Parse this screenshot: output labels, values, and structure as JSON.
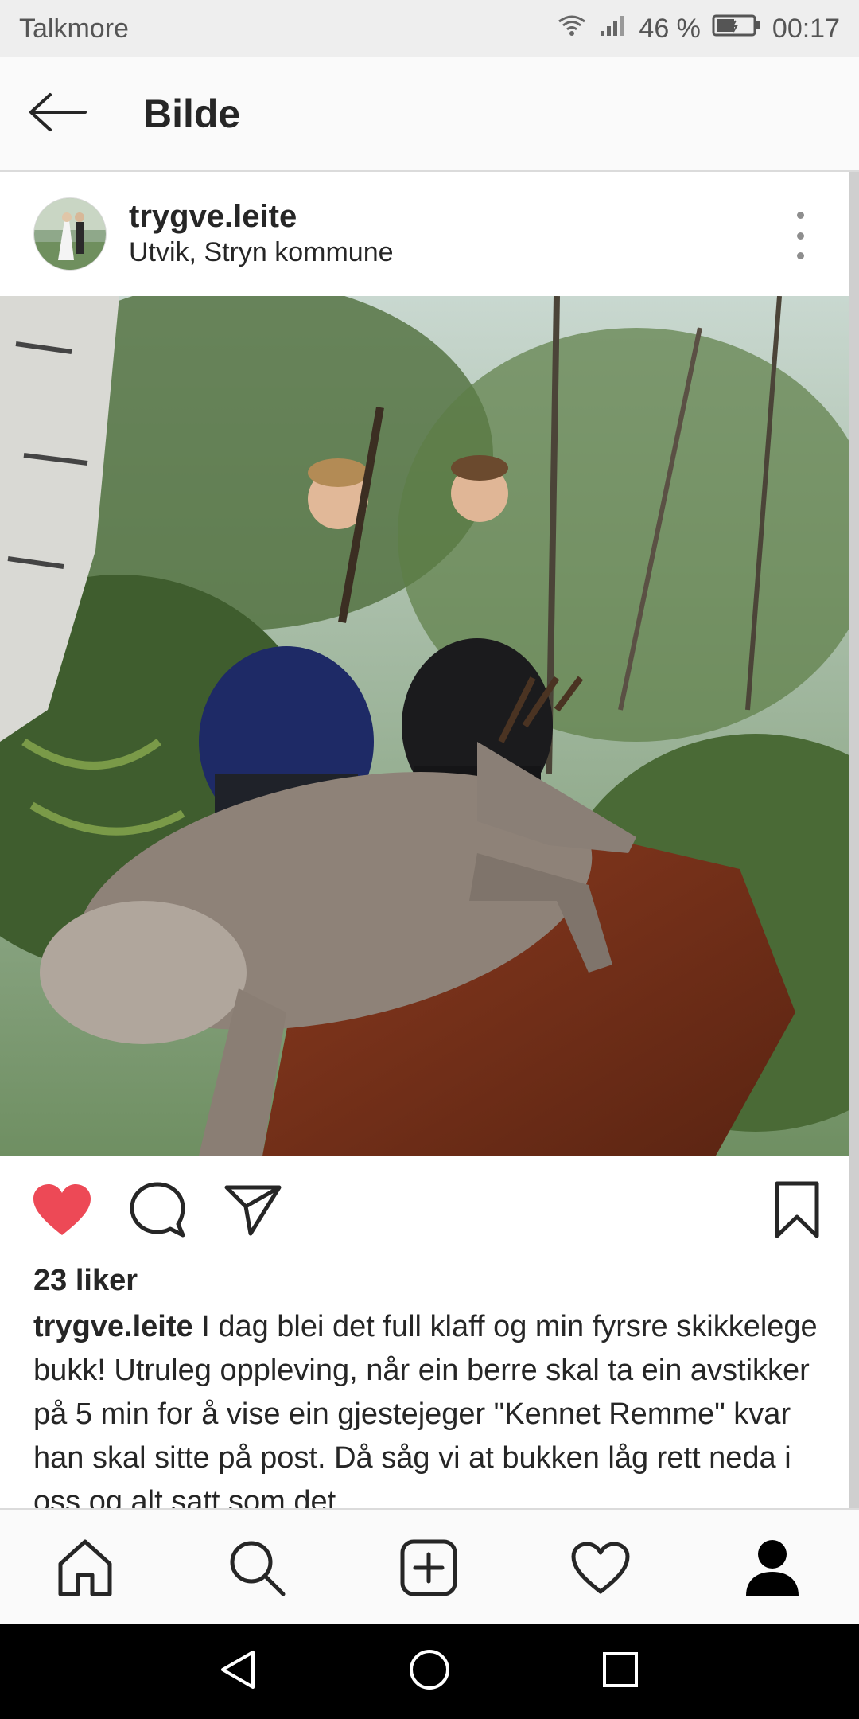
{
  "status_bar": {
    "carrier": "Talkmore",
    "battery": "46 %",
    "time": "00:17",
    "icons": [
      "wifi-icon",
      "signal-icon",
      "battery-icon"
    ]
  },
  "app_bar": {
    "title": "Bilde",
    "back_icon": "arrow-left-icon"
  },
  "post": {
    "username": "trygve.leite",
    "location": "Utvik, Stryn kommune",
    "more_icon": "more-vertical-icon",
    "liked": true,
    "likes": "23 liker",
    "caption_user": "trygve.leite",
    "caption_text": " I dag blei det full klaff og min fyrsre skikkelege bukk! Utruleg oppleving, når ein berre skal ta ein avstikker på 5 min for å vise ein gjestejeger \"Kennet Remme\" kvar han skal sitte på post. Då såg vi at bukken låg rett neda i oss og alt satt som det",
    "action_icons": [
      "heart-filled-icon",
      "comment-icon",
      "share-icon",
      "bookmark-icon"
    ]
  },
  "bottom_nav": {
    "items": [
      "home-icon",
      "search-icon",
      "add-post-icon",
      "activity-heart-icon",
      "profile-icon"
    ]
  },
  "system_nav": {
    "items": [
      "back-triangle-icon",
      "home-circle-icon",
      "recents-square-icon"
    ]
  },
  "colors": {
    "like_red": "#ed4956",
    "text": "#262626",
    "status_bar": "#eeeeee"
  }
}
